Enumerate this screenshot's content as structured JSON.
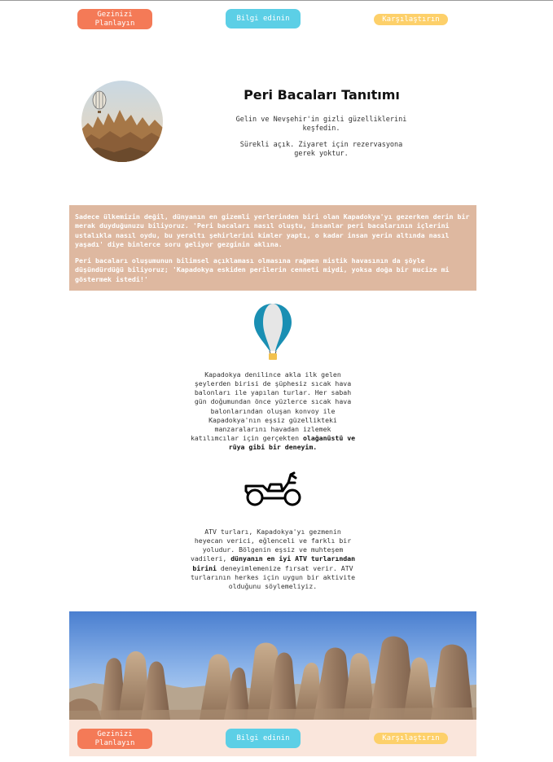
{
  "nav": {
    "plan_label": "Gezinizi Planlayın",
    "info_label": "Bilgi edinin",
    "compare_label": "Karşılaştırın"
  },
  "hero": {
    "title": "Peri Bacaları Tanıtımı",
    "subtitle": "Gelin ve Nevşehir'in gizli güzelliklerini keşfedin.",
    "note": "Sürekli açık. Ziyaret için rezervasyona gerek yoktur."
  },
  "intro": {
    "p1": "Sadece ülkemizin değil, dünyanın en gizemli yerlerinden biri olan Kapadokya'yı gezerken derin bir merak duyduğunuzu biliyoruz. 'Peri bacaları nasıl oluştu, insanlar peri bacalarının içlerini ustalıkla nasıl oydu, bu yeraltı şehirlerini kimler yaptı, o kadar insan yerin altında nasıl yaşadı' diye binlerce soru geliyor gezginin aklına.",
    "p2": "Peri bacaları oluşumunun bilimsel açıklaması olmasına rağmen mistik havasının da şöyle düşündürdüğü biliyoruz; 'Kapadokya eskiden perilerin cenneti miydi, yoksa doğa bir mucize mi göstermek istedi!'"
  },
  "balloon": {
    "icon": "hot-air-balloon-icon",
    "text": "Kapadokya denilince akla ilk gelen şeylerden birisi de şüphesiz sıcak hava balonları ile yapılan turlar. Her sabah gün doğumundan önce yüzlerce sıcak hava balonlarından oluşan konvoy ile Kapadokya'nın eşsiz güzellikteki manzaralarını havadan izlemek katılımcılar için gerçekten ",
    "bold": "olağanüstü ve rüya gibi bir deneyim."
  },
  "atv": {
    "icon": "atv-motorbike-icon",
    "text_a": "ATV turları, Kapadokya'yı gezmenin heyecan verici, eğlenceli ve farklı bir yoludur. Bölgenin eşsiz ve muhteşem vadileri, ",
    "bold": "dünyanın en iyi ATV turlarından birini",
    "text_b": " deneyimlemenize fırsat verir. ATV turlarının herkes için uygun bir aktivite olduğunu söylemeliyiz."
  },
  "colors": {
    "plan": "#f47a57",
    "info": "#5ccfe6",
    "compare": "#fdd06a",
    "intro_bg": "#deb8a0",
    "footer_bg": "#fae6dc",
    "balloon_blue": "#1a8fb3"
  }
}
